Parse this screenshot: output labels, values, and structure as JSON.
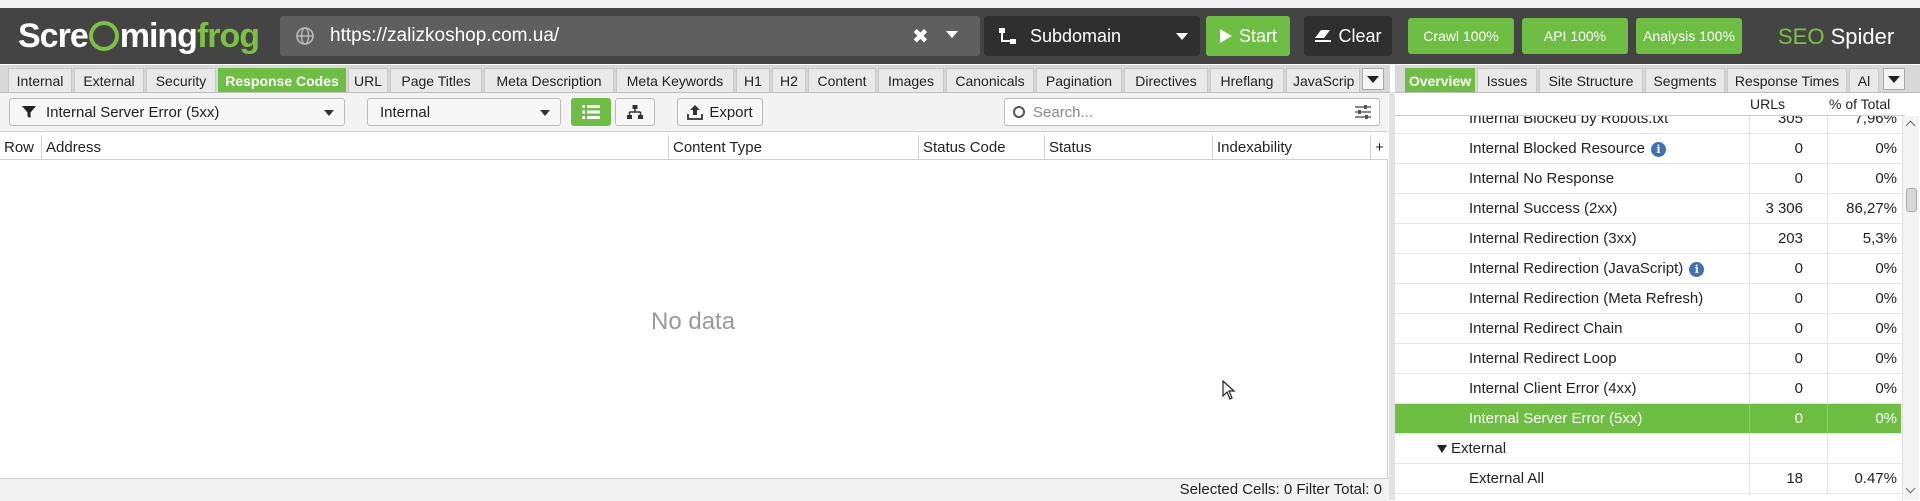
{
  "app": {
    "url": "https://zalizkoshop.com.ua/",
    "mode": "Subdomain",
    "start_label": "Start",
    "clear_label": "Clear",
    "crawl_label": "Crawl 100%",
    "api_label": "API 100%",
    "analysis_label": "Analysis 100%",
    "brand_a": "SEO",
    "brand_b": "Spider",
    "logo_a": "Scre",
    "logo_b": "ming",
    "logo_c": "frog"
  },
  "tabs": [
    {
      "label": "Internal"
    },
    {
      "label": "External"
    },
    {
      "label": "Security"
    },
    {
      "label": "Response Codes",
      "active": true
    },
    {
      "label": "URL"
    },
    {
      "label": "Page Titles"
    },
    {
      "label": "Meta Description"
    },
    {
      "label": "Meta Keywords"
    },
    {
      "label": "H1"
    },
    {
      "label": "H2"
    },
    {
      "label": "Content"
    },
    {
      "label": "Images"
    },
    {
      "label": "Canonicals"
    },
    {
      "label": "Pagination"
    },
    {
      "label": "Directives"
    },
    {
      "label": "Hreflang"
    },
    {
      "label": "JavaScrip"
    }
  ],
  "right_tabs": [
    {
      "label": "Overview",
      "active": true
    },
    {
      "label": "Issues"
    },
    {
      "label": "Site Structure"
    },
    {
      "label": "Segments"
    },
    {
      "label": "Response Times"
    },
    {
      "label": "Al"
    }
  ],
  "toolbar": {
    "filter_value": "Internal Server Error (5xx)",
    "scope_value": "Internal",
    "export_label": "Export",
    "search_placeholder": "Search..."
  },
  "table": {
    "columns": [
      "Row",
      "Address",
      "Content Type",
      "Status Code",
      "Status",
      "Indexability"
    ],
    "empty_text": "No data"
  },
  "footer": {
    "text": "Selected Cells:  0  Filter Total:  0"
  },
  "overview": {
    "col_urls": "URLs",
    "col_pct": "% of Total",
    "rows": [
      {
        "label": "Internal Blocked by Robots.txt",
        "urls": "305",
        "pct": "7,96%"
      },
      {
        "label": "Internal Blocked Resource",
        "urls": "0",
        "pct": "0%",
        "info": true
      },
      {
        "label": "Internal No Response",
        "urls": "0",
        "pct": "0%"
      },
      {
        "label": "Internal Success (2xx)",
        "urls": "3 306",
        "pct": "86,27%"
      },
      {
        "label": "Internal Redirection (3xx)",
        "urls": "203",
        "pct": "5,3%"
      },
      {
        "label": "Internal Redirection (JavaScript)",
        "urls": "0",
        "pct": "0%",
        "info": true
      },
      {
        "label": "Internal Redirection (Meta Refresh)",
        "urls": "0",
        "pct": "0%"
      },
      {
        "label": "Internal Redirect Chain",
        "urls": "0",
        "pct": "0%"
      },
      {
        "label": "Internal Redirect Loop",
        "urls": "0",
        "pct": "0%"
      },
      {
        "label": "Internal Client Error (4xx)",
        "urls": "0",
        "pct": "0%"
      },
      {
        "label": "Internal Server Error (5xx)",
        "urls": "0",
        "pct": "0%",
        "selected": true
      },
      {
        "label": "External",
        "urls": "",
        "pct": "",
        "group": true
      },
      {
        "label": "External All",
        "urls": "18",
        "pct": "0.47%"
      }
    ]
  },
  "colors": {
    "accent_green": "#6fbe44",
    "header_dark": "#444444",
    "info_blue": "#3f6fb4"
  }
}
